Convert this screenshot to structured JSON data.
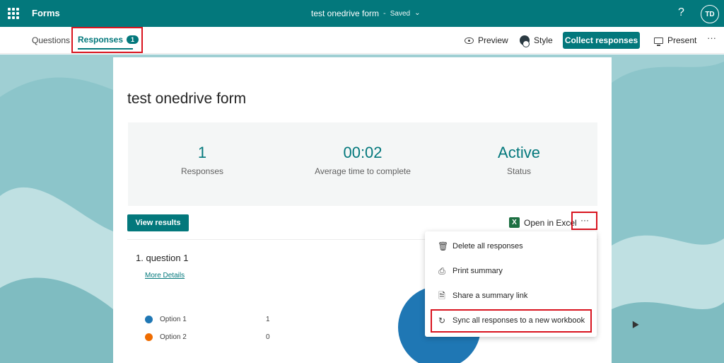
{
  "topbar": {
    "app_name": "Forms",
    "doc_title": "test onedrive form",
    "separator": "-",
    "save_status": "Saved",
    "help_glyph": "?",
    "avatar_initials": "TD"
  },
  "tabs": {
    "questions_label": "Questions",
    "responses_label": "Responses",
    "responses_count": "1"
  },
  "toolbar": {
    "preview_label": "Preview",
    "style_label": "Style",
    "collect_label": "Collect responses",
    "present_label": "Present",
    "more_glyph": "···"
  },
  "form": {
    "title": "test onedrive form",
    "stats": [
      {
        "value": "1",
        "label": "Responses"
      },
      {
        "value": "00:02",
        "label": "Average time to complete"
      },
      {
        "value": "Active",
        "label": "Status"
      }
    ],
    "view_results_label": "View results",
    "open_excel_label": "Open in Excel",
    "more_glyph": "···",
    "question": {
      "number": "1.",
      "title": "question 1",
      "details_label": "More Details",
      "options": [
        {
          "label": "Option 1",
          "count": "1",
          "color": "#1f77b4"
        },
        {
          "label": "Option 2",
          "count": "0",
          "color": "#ef6c00"
        }
      ]
    }
  },
  "menu": {
    "items": [
      {
        "label": "Delete all responses",
        "icon": "trash-icon"
      },
      {
        "label": "Print summary",
        "icon": "printer-icon"
      },
      {
        "label": "Share a summary link",
        "icon": "share-doc-icon"
      },
      {
        "label": "Sync all responses to a new workbook",
        "icon": "sync-workbook-icon"
      }
    ]
  },
  "colors": {
    "brand": "#03787c",
    "highlight": "#d9141f",
    "background": "#9fcfd3"
  }
}
